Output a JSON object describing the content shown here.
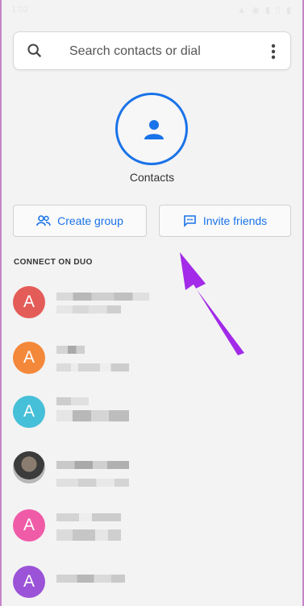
{
  "status_bar": {
    "time": "1:02",
    "icons": "▲ ◉ ▮ ▯ ▮"
  },
  "search": {
    "placeholder": "Search contacts or dial"
  },
  "contacts": {
    "label": "Contacts"
  },
  "actions": {
    "create_group": "Create group",
    "invite_friends": "Invite friends"
  },
  "section": {
    "title": "CONNECT ON DUO"
  },
  "rows": [
    {
      "avatar": "A",
      "color": "#e45c58"
    },
    {
      "avatar": "A",
      "color": "#f4883a"
    },
    {
      "avatar": "A",
      "color": "#46bfd8"
    },
    {
      "avatar": "",
      "color": "photo"
    },
    {
      "avatar": "A",
      "color": "#f05ba8"
    },
    {
      "avatar": "A",
      "color": "#9b53d8"
    }
  ],
  "colors": {
    "accent": "#1a73e8",
    "arrow": "#a22ae8"
  }
}
